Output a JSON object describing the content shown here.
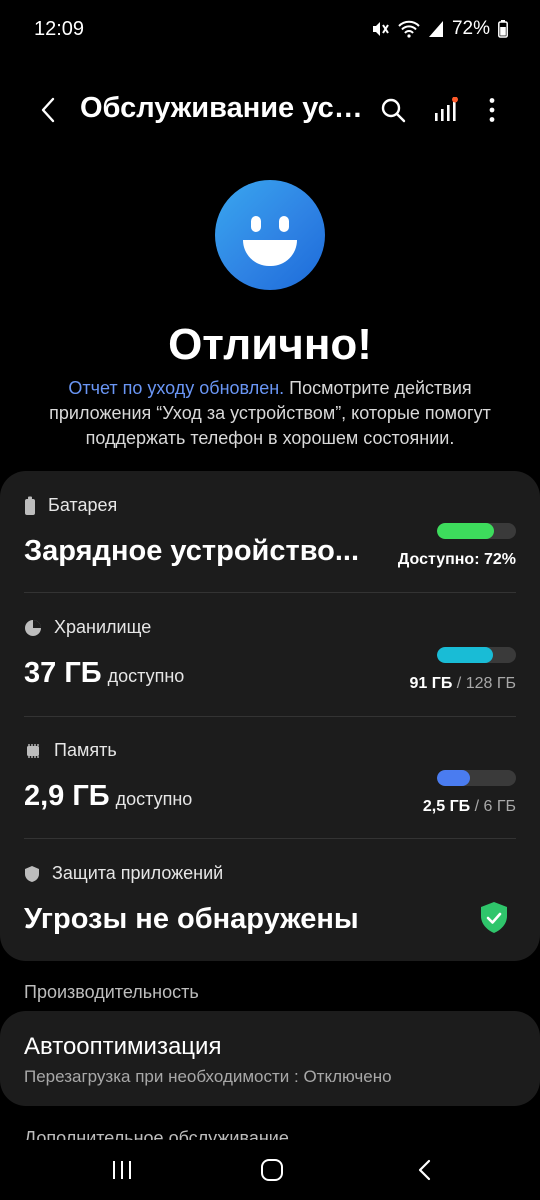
{
  "status_bar": {
    "time": "12:09",
    "battery_percent": "72%"
  },
  "app_bar": {
    "title": "Обслуживание устройства"
  },
  "hero": {
    "headline": "Отлично!",
    "report_link": "Отчет по уходу обновлен.",
    "report_text": " Посмотрите действия приложения “Уход за устройством”, которые помогут поддержать телефон в хорошем состоянии."
  },
  "battery": {
    "label": "Батарея",
    "value": "Зарядное устройство...",
    "available": "Доступно: 72%",
    "fill_percent": 72,
    "color": "#3ddc5c"
  },
  "storage": {
    "label": "Хранилище",
    "value": "37 ГБ",
    "suffix": "доступно",
    "used": "91 ГБ",
    "total": "/ 128 ГБ",
    "fill_percent": 71,
    "color": "#19bcd6"
  },
  "memory": {
    "label": "Память",
    "value": "2,9 ГБ",
    "suffix": "доступно",
    "used": "2,5 ГБ",
    "total": "/ 6 ГБ",
    "fill_percent": 42,
    "color": "#4a7cf0"
  },
  "app_protection": {
    "label": "Защита приложений",
    "value": "Угрозы не обнаружены",
    "shield_color": "#2fc56b"
  },
  "performance": {
    "header": "Производительность",
    "auto_title": "Автооптимизация",
    "auto_subtitle": "Перезагрузка при необходимости : Отключено"
  },
  "next_section": {
    "header": "Дополнительное обслуживание"
  }
}
